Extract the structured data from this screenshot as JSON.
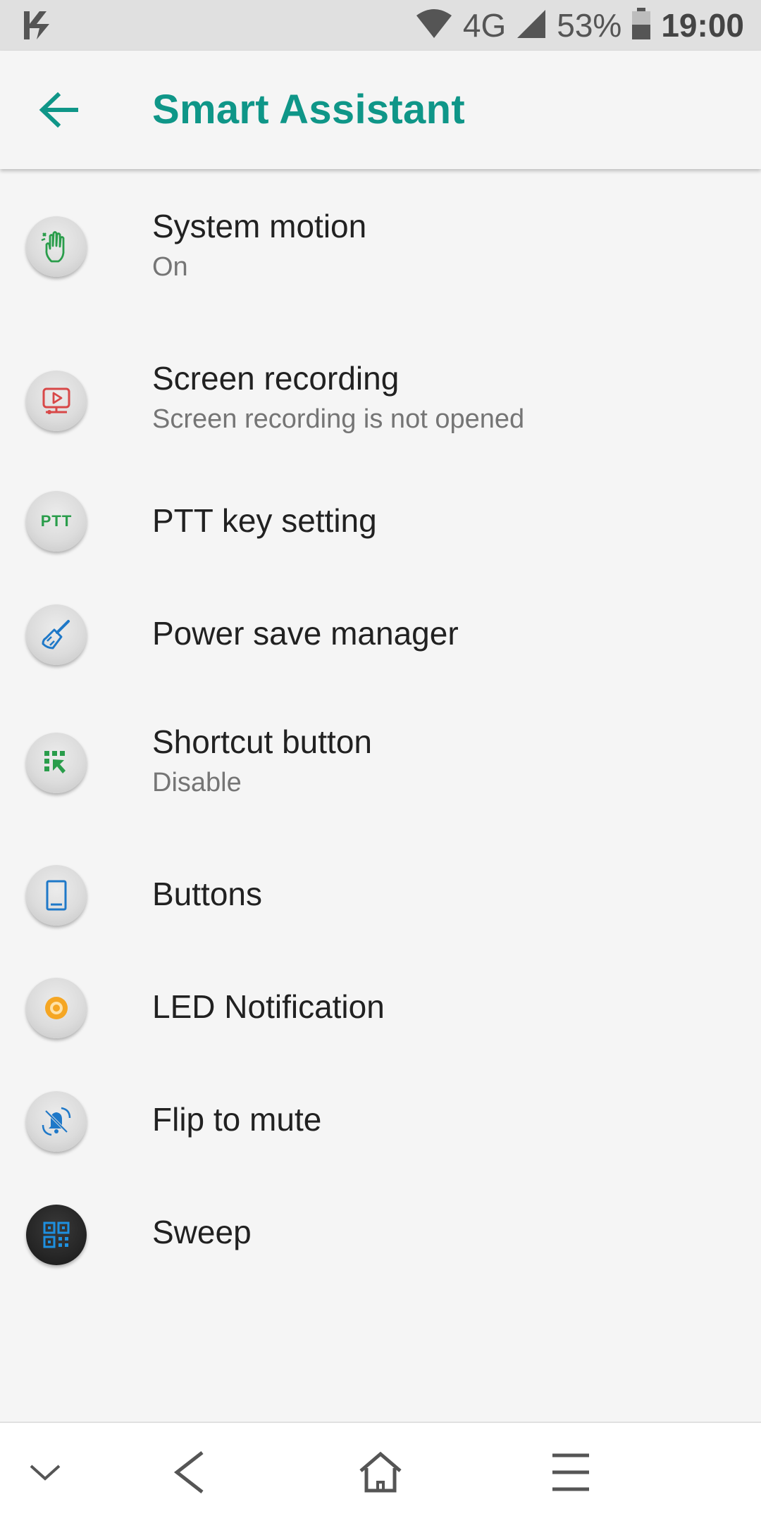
{
  "status_bar": {
    "network": "4G",
    "battery": "53%",
    "time": "19:00",
    "icons": [
      "app-notification-icon",
      "wifi-icon",
      "signal-icon",
      "battery-icon"
    ]
  },
  "app_bar": {
    "title": "Smart Assistant",
    "back_icon": "arrow-left-icon",
    "accent_color": "#0f9688"
  },
  "items": [
    {
      "title": "System motion",
      "subtitle": "On",
      "icon": "hand-gesture-icon"
    },
    {
      "title": "Screen recording",
      "subtitle": "Screen recording is not opened",
      "icon": "screen-record-icon"
    },
    {
      "title": "PTT key setting",
      "subtitle": "",
      "icon": "ptt-icon",
      "icon_text": "PTT"
    },
    {
      "title": "Power save manager",
      "subtitle": "",
      "icon": "broom-icon"
    },
    {
      "title": "Shortcut button",
      "subtitle": "Disable",
      "icon": "shortcut-icon"
    },
    {
      "title": "Buttons",
      "subtitle": "",
      "icon": "phone-button-icon"
    },
    {
      "title": "LED Notification",
      "subtitle": "",
      "icon": "led-icon"
    },
    {
      "title": "Flip to mute",
      "subtitle": "",
      "icon": "mute-bell-icon"
    },
    {
      "title": "Sweep",
      "subtitle": "",
      "icon": "qr-code-icon"
    }
  ],
  "nav_bar": {
    "buttons": [
      "collapse-icon",
      "back-icon",
      "home-icon",
      "menu-icon"
    ]
  }
}
